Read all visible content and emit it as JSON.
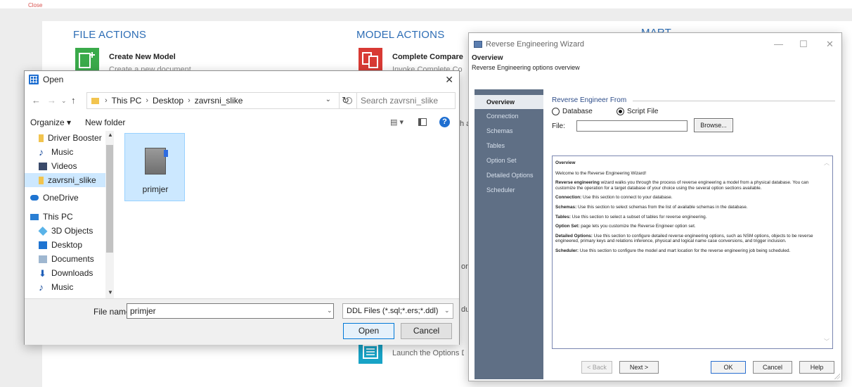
{
  "background": {
    "close_label": "Close",
    "file_actions_title": "FILE ACTIONS",
    "model_actions_title": "MODEL ACTIONS",
    "mart_title": "MART",
    "create_model_title": "Create New Model",
    "create_model_sub": "Create a new document",
    "complete_compare_title": "Complete Compare",
    "complete_compare_sub": "Invoke Complete Compare",
    "options_sub": "Launch the Options Dialog",
    "partial_a": "h a",
    "partial_or": "or",
    "partial_du": "du"
  },
  "open_dialog": {
    "title": "Open",
    "close_icon": "✕",
    "address": {
      "crumbs": [
        "This PC",
        "Desktop",
        "zavrsni_slike"
      ]
    },
    "search_placeholder": "Search zavrsni_slike",
    "organize_label": "Organize ▾",
    "new_folder_label": "New folder",
    "help_label": "?",
    "tree": [
      {
        "label": "Driver Booster",
        "icon": "folder-icon"
      },
      {
        "label": "Music",
        "icon": "music-icon"
      },
      {
        "label": "Videos",
        "icon": "videos-icon"
      },
      {
        "label": "zavrsni_slike",
        "icon": "folder-icon",
        "selected": true
      },
      {
        "label": "OneDrive",
        "icon": "cloud-icon"
      },
      {
        "label": "This PC",
        "icon": "pc-icon"
      },
      {
        "label": "3D Objects",
        "icon": "3d-objects-icon"
      },
      {
        "label": "Desktop",
        "icon": "desktop-icon"
      },
      {
        "label": "Documents",
        "icon": "documents-icon"
      },
      {
        "label": "Downloads",
        "icon": "downloads-icon"
      },
      {
        "label": "Music",
        "icon": "music-icon"
      }
    ],
    "files": [
      {
        "name": "primjer",
        "selected": true
      }
    ],
    "file_name_label": "File name:",
    "file_name_value": "primjer",
    "file_type_value": "DDL Files (*.sql;*.ers;*.ddl)",
    "open_button": "Open",
    "cancel_button": "Cancel"
  },
  "wizard": {
    "title": "Reverse Engineering Wizard",
    "header_title": "Overview",
    "header_sub": "Reverse Engineering options overview",
    "nav": [
      "Overview",
      "Connection",
      "Schemas",
      "Tables",
      "Option Set",
      "Detailed Options",
      "Scheduler"
    ],
    "active_nav": "Overview",
    "group_title": "Reverse Engineer From",
    "radio_database": "Database",
    "radio_script": "Script File",
    "selected_source": "Script File",
    "file_label": "File:",
    "file_value": "",
    "browse_button": "Browse...",
    "info_heading": "Overview",
    "info_welcome": "Welcome to the Reverse Engineering Wizard!",
    "info_p1_bold": "Reverse engineering",
    "info_p1_text": " wizard walks you through the process of reverse engineering a model from a physical database. You can customize the operation for a target database of your choice using the several option sections available.",
    "info_p2_bold": "Connection:",
    "info_p2_text": " Use this section to connect to your database.",
    "info_p3_bold": "Schemas:",
    "info_p3_text": " Use this section to select schemas from the list of available schemas in the database.",
    "info_p4_bold": "Tables:",
    "info_p4_text": " Use this section to select a subset of tables for reverse engineering.",
    "info_p5_bold": "Option Set:",
    "info_p5_text": " page lets you customize the Reverse Engineer option set.",
    "info_p6_bold": "Detailed Options:",
    "info_p6_text": " Use this section to configure detailed reverse engineering options, such as NSM options, objects to be reverse engineered, primary keys and relations inference, physical and logical name case conversions, and trigger inclusion.",
    "info_p7_bold": "Scheduler:",
    "info_p7_text": " Use this section to configure the model and mart location for the reverse engineering job being scheduled.",
    "back_button": "< Back",
    "next_button": "Next >",
    "ok_button": "OK",
    "cancel_button": "Cancel",
    "help_button": "Help"
  },
  "colors": {
    "accent_blue": "#2d6db5",
    "wizard_sidebar": "#5f6f85",
    "selection": "#cde8ff"
  }
}
